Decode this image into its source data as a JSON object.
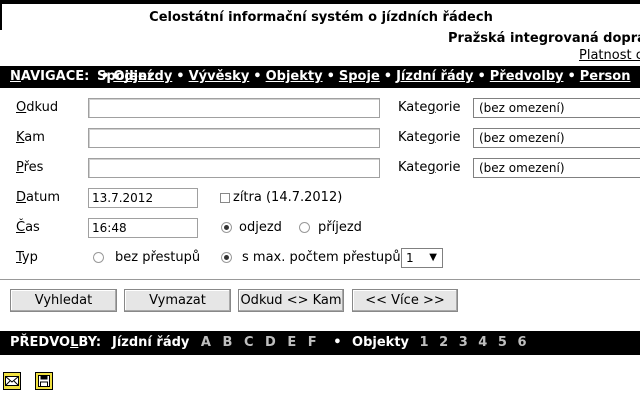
{
  "header": {
    "title": "Celostátní informační systém o jízdních řádech",
    "organization": "Pražská integrovaná doprav",
    "validity_link": "Platnost c"
  },
  "nav": {
    "label": "NAVIGACE:",
    "items": [
      "Spojení",
      "Odjezdy",
      "Vývěsky",
      "Objekty",
      "Spoje",
      "Jízdní řády",
      "Předvolby",
      "Person"
    ]
  },
  "form": {
    "from_label": "Odkud",
    "to_label": "Kam",
    "via_label": "Přes",
    "category_label": "Kategorie",
    "category_value": "(bez omezení)",
    "from_value": "",
    "to_value": "",
    "via_value": "",
    "date_label": "Datum",
    "date_value": "13.7.2012",
    "tomorrow_label": "zítra (14.7.2012)",
    "time_label": "Čas",
    "time_value": "16:48",
    "departure_label": "odjezd",
    "arrival_label": "příjezd",
    "type_label": "Typ",
    "no_transfer_label": "bez přestupů",
    "max_transfer_label": "s max. počtem přestupů",
    "max_transfer_value": "1"
  },
  "buttons": {
    "search": "Vyhledat",
    "clear": "Vymazat",
    "swap": "Odkud <> Kam",
    "more": "<< Více >>"
  },
  "preferences": {
    "label": "PŘEDVOLBY:",
    "timetables_label": "Jízdní řády",
    "timetable_letters": [
      "A",
      "B",
      "C",
      "D",
      "E",
      "F"
    ],
    "objects_label": "Objekty",
    "object_numbers": [
      "1",
      "2",
      "3",
      "4",
      "5",
      "6"
    ]
  },
  "icons": {
    "envelope": "envelope-icon",
    "save": "save-icon"
  }
}
